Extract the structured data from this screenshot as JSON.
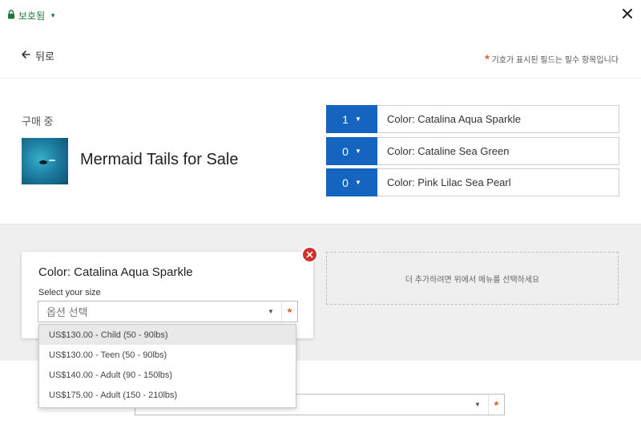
{
  "topbar": {
    "secure_label": "보호됨",
    "lock_icon": "lock-icon",
    "close_icon": "close-icon",
    "secure_color": "#1f7a3a"
  },
  "header": {
    "back_label": "뒤로",
    "required_note": "기호가 표시된 필드는 필수 항목입니다",
    "required_symbol": "*"
  },
  "product": {
    "buying_label": "구매 중",
    "title": "Mermaid Tails for Sale",
    "variants": [
      {
        "qty": "1",
        "label": "Color: Catalina Aqua Sparkle"
      },
      {
        "qty": "0",
        "label": "Color: Cataline Sea Green"
      },
      {
        "qty": "0",
        "label": "Color: Pink Lilac Sea Pearl"
      }
    ],
    "accent_color": "#1565c0"
  },
  "option_card": {
    "title": "Color: Catalina Aqua Sparkle",
    "size_label": "Select your size",
    "select_placeholder": "옵션 선택",
    "remove_color": "#d32f2f"
  },
  "add_more": {
    "text": "더 추가하려면 위에서 메뉴를 선택하세요"
  },
  "dropdown": {
    "options": [
      "US$130.00 - Child (50 - 90lbs)",
      "US$130.00 - Teen (50 - 90lbs)",
      "US$140.00 - Adult (90 - 150lbs)",
      "US$175.00 - Adult (150 - 210lbs)"
    ]
  }
}
